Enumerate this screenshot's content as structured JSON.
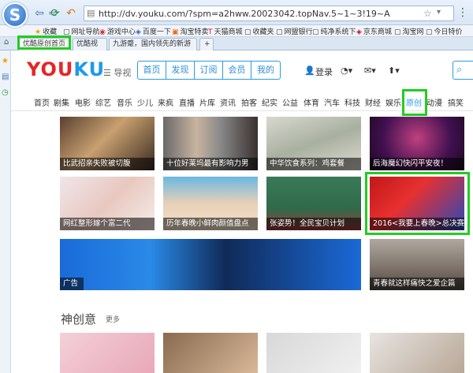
{
  "browser": {
    "url": "http://dv.youku.com/?spm=a2hww.20023042.topNav.5~1~3!19~A",
    "favorites": [
      {
        "icon": "★",
        "label": "收藏"
      },
      {
        "icon": "▢",
        "label": "网址导航"
      },
      {
        "icon": "◉",
        "label": "游戏中心"
      },
      {
        "icon": "◈",
        "label": "百度一下"
      },
      {
        "icon": "▣",
        "label": "淘宝特卖"
      },
      {
        "icon": "T",
        "label": "天猫商城"
      },
      {
        "icon": "▢",
        "label": "收藏夹"
      },
      {
        "icon": "▢",
        "label": "网盟银行"
      },
      {
        "icon": "▢",
        "label": "纯净系统下"
      },
      {
        "icon": "◈",
        "label": "京东商城"
      },
      {
        "icon": "▢",
        "label": "淘宝网"
      },
      {
        "icon": "▢",
        "label": "今日特价"
      }
    ],
    "tabs": [
      {
        "label": "优酷原创首页"
      },
      {
        "label": "优酷视"
      },
      {
        "label": "九游蹙，国内领先的新游"
      }
    ]
  },
  "youku": {
    "logo_red": "YOU",
    "logo_blue": "KU",
    "guide": "☰ 导视",
    "nav": [
      "首页",
      "发现",
      "订阅",
      "会员",
      "我的"
    ],
    "login": "登录",
    "categories": [
      "首页",
      "剧集",
      "电影",
      "综艺",
      "音乐",
      "少儿",
      "来疯",
      "直播",
      "片库",
      "资讯",
      "拍客",
      "纪实",
      "公益",
      "体育",
      "汽车",
      "科技",
      "财经",
      "娱乐",
      "原创",
      "动漫",
      "搞笑"
    ],
    "tiles": [
      {
        "caption": "比武招亲失败被切腹"
      },
      {
        "caption": "十位好莱坞最有影响力男"
      },
      {
        "caption": "中华饮食系列：鸡套餐"
      },
      {
        "caption": "后海魔幻快闪平安夜！"
      },
      {
        "caption": "网红整形嫁个富二代"
      },
      {
        "caption": "历年春晚小鲜肉颜值盘点"
      },
      {
        "caption": "张姿势！全民宝贝计划"
      },
      {
        "caption": "2016<我要上春晚>总决赛"
      },
      {
        "caption": "广告"
      },
      {
        "caption": "青春就这样痛快之爱企篇"
      }
    ],
    "section_title": "神创意",
    "section_more": "更多"
  }
}
